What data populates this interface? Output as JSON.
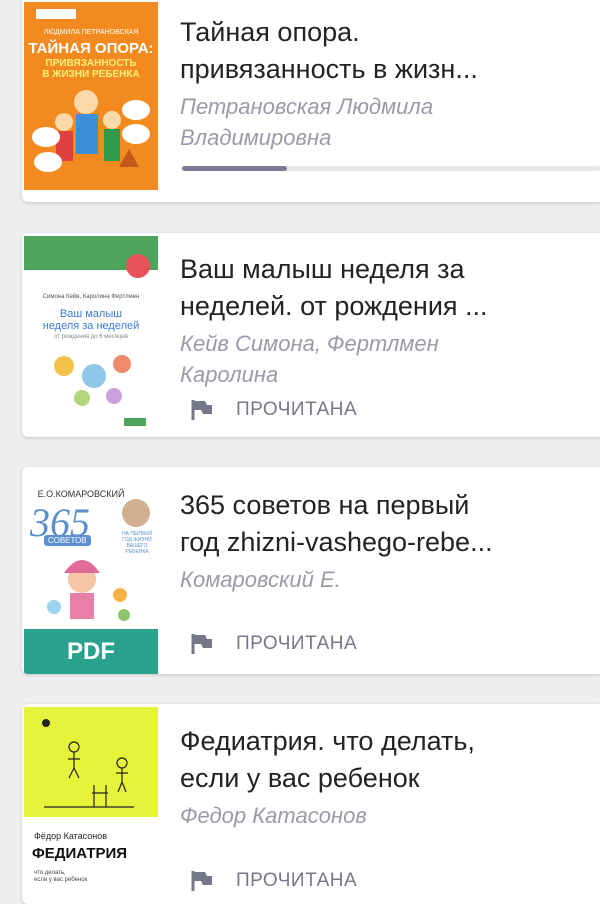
{
  "books": [
    {
      "title": "Тайная опора.\nпривязанность в жизн...",
      "author": "Петрановская Людмила\nВладимировна",
      "progress": 0.25,
      "cover": {
        "author": "ЛЮДМИЛА ПЕТРАНОВСКАЯ",
        "title": "ТАЙНАЯ ОПОРА:",
        "subtitle": "ПРИВЯЗАННОСТЬ\nВ ЖИЗНИ РЕБЕНКА",
        "bg": "#f28a1f"
      }
    },
    {
      "title": "Ваш малыш неделя за\nнеделей. от рождения ...",
      "author": "Кейв Симона, Фертлмен\nКаролина",
      "status": "ПРОЧИТАНА",
      "cover": {
        "author": "Симона Кейв, Каролина Фертлмен",
        "title": "Ваш малыш\nнеделя за неделей",
        "subtitle": "от рождения до 6 месяцев",
        "bg": "#ffffff",
        "band": "#4da45a"
      }
    },
    {
      "title": "365 советов на первый\nгод zhizni-vashego-rebe...",
      "author": "Комаровский Е.",
      "status": "ПРОЧИТАНА",
      "cover": {
        "author": "Е.О.КОМАРОВСКИЙ",
        "title": "365",
        "subtitle": "СОВЕТОВ",
        "note": "НА ПЕРВЫЙ\nГОД ЖИЗНИ\nВАШЕГО РЕБЕНКА",
        "badge": "PDF",
        "bg": "#ffffff"
      }
    },
    {
      "title": "Федиатрия. что делать,\nесли у вас ребенок",
      "author": "Федор Катасонов",
      "status": "ПРОЧИТАНА",
      "cover": {
        "author": "Фёдор Катасонов",
        "title": "ФЕДИАТРИЯ",
        "subtitle": "что делать,\nесли у вас ребенок",
        "bg": "#e7f23b"
      }
    }
  ],
  "colors": {
    "status_text": "#77778a",
    "progress_fill": "#7c7c95",
    "pdf_badge": "#2aa18d"
  }
}
